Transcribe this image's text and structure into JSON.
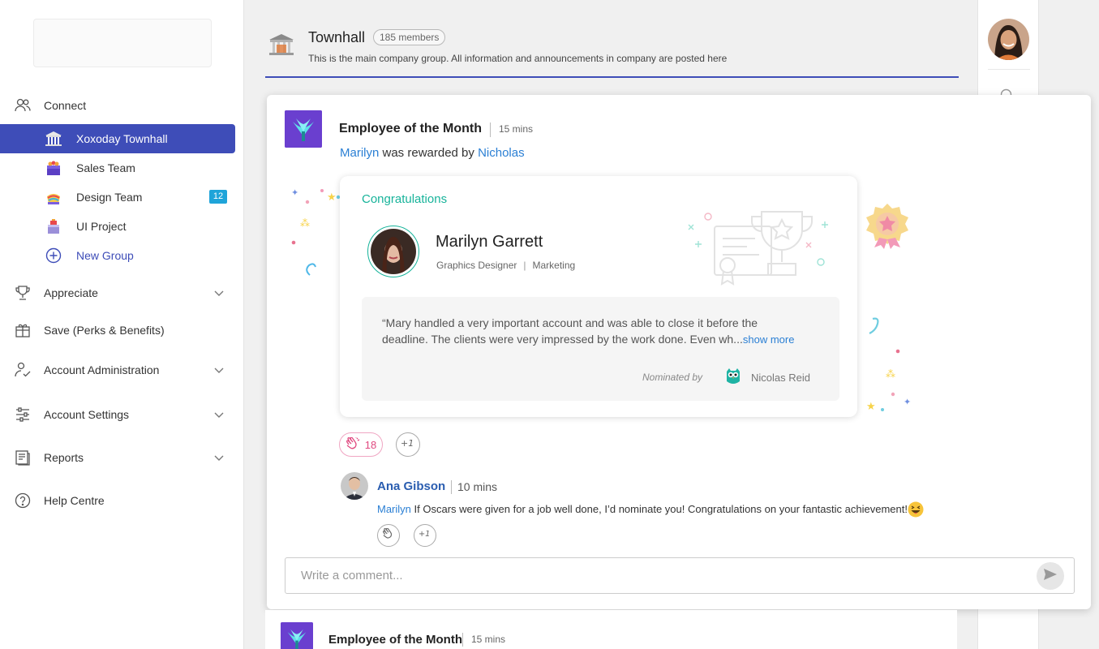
{
  "sidebar": {
    "connect_label": "Connect",
    "groups": [
      {
        "label": "Xoxoday Townhall",
        "icon": "townhall-icon",
        "active": true
      },
      {
        "label": "Sales Team",
        "icon": "sales-team-icon"
      },
      {
        "label": "Design Team",
        "icon": "design-team-icon",
        "badge": "12"
      },
      {
        "label": "UI Project",
        "icon": "ui-project-icon"
      }
    ],
    "new_group_label": "New Group",
    "appreciate_label": "Appreciate",
    "save_label": "Save (Perks & Benefits)",
    "account_admin_label": "Account Administration",
    "account_settings_label": "Account Settings",
    "reports_label": "Reports",
    "help_label": "Help Centre"
  },
  "group": {
    "title": "Townhall",
    "members": "185 members",
    "description": "This is the main company group. All information and announcements in company are posted here"
  },
  "post": {
    "title": "Employee of the Month",
    "time": "15 mins",
    "recipient": "Marilyn",
    "rewarded_by_text": " was rewarded by ",
    "giver": "Nicholas",
    "award": {
      "heading": "Congratulations",
      "name": "Marilyn Garrett",
      "role": "Graphics Designer",
      "department": "Marketing",
      "quote": "“Mary handled a very important account and was able to close it before the deadline. The clients were very impressed by the work done. Even wh...",
      "show_more": "show more",
      "nominated_by_label": "Nominated by",
      "nominator": "Nicolas Reid"
    },
    "clap_count": "18",
    "plus_one": "+1",
    "comment": {
      "author": "Ana Gibson",
      "time": "10 mins",
      "mention": "Marilyn",
      "text": " If Oscars were given for a job well done, I’d nominate you! Congratulations on your fantastic achievement!"
    },
    "comment_placeholder": "Write a comment..."
  },
  "next_post": {
    "title": "Employee of the Month",
    "time": "15 mins"
  },
  "colors": {
    "accent": "#3e4db8",
    "teal": "#17b39a",
    "link": "#2a7fd4",
    "badge": "#1fa4d9",
    "clap": "#e0487f"
  }
}
